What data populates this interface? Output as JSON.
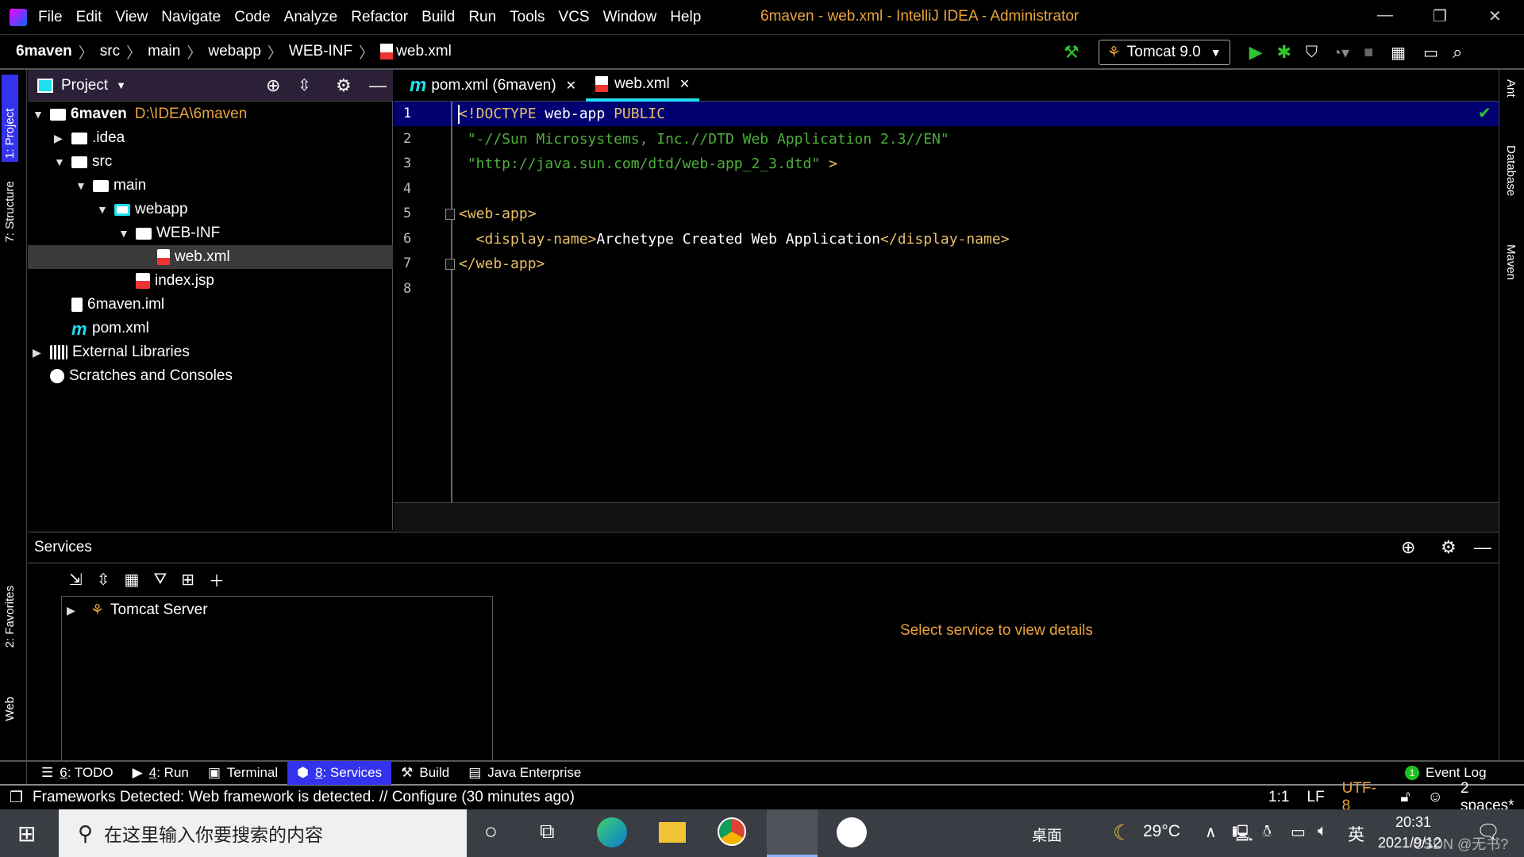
{
  "app": {
    "title": "6maven - web.xml - IntelliJ IDEA - Administrator",
    "menu": [
      "File",
      "Edit",
      "View",
      "Navigate",
      "Code",
      "Analyze",
      "Refactor",
      "Build",
      "Run",
      "Tools",
      "VCS",
      "Window",
      "Help"
    ]
  },
  "breadcrumb": [
    "6maven",
    "src",
    "main",
    "webapp",
    "WEB-INF",
    "web.xml"
  ],
  "run_config": "Tomcat 9.0",
  "project": {
    "title": "Project",
    "tree": [
      {
        "label": "6maven",
        "path": "D:\\IDEA\\6maven",
        "depth": 0,
        "expanded": true,
        "icon": "module-folder"
      },
      {
        "label": ".idea",
        "depth": 1,
        "expanded": false,
        "icon": "folder"
      },
      {
        "label": "src",
        "depth": 1,
        "expanded": true,
        "icon": "folder"
      },
      {
        "label": "main",
        "depth": 2,
        "expanded": true,
        "icon": "folder"
      },
      {
        "label": "webapp",
        "depth": 3,
        "expanded": true,
        "icon": "web-folder"
      },
      {
        "label": "WEB-INF",
        "depth": 4,
        "expanded": true,
        "icon": "folder"
      },
      {
        "label": "web.xml",
        "depth": 5,
        "icon": "xml-file",
        "selected": true
      },
      {
        "label": "index.jsp",
        "depth": 4,
        "icon": "jsp-file"
      },
      {
        "label": "6maven.iml",
        "depth": 1,
        "icon": "iml-file"
      },
      {
        "label": "pom.xml",
        "depth": 1,
        "icon": "maven-file"
      },
      {
        "label": "External Libraries",
        "depth": 0,
        "expanded": false,
        "icon": "libraries"
      },
      {
        "label": "Scratches and Consoles",
        "depth": 0,
        "icon": "scratches"
      }
    ]
  },
  "editor": {
    "tabs": [
      {
        "label": "pom.xml (6maven)",
        "active": false
      },
      {
        "label": "web.xml",
        "active": true
      }
    ],
    "lines": [
      [
        [
          "tag",
          "<!DOCTYPE "
        ],
        [
          "txt",
          "web-app "
        ],
        [
          "kw",
          "PUBLIC"
        ]
      ],
      [
        [
          "str",
          " \"-//Sun Microsystems, Inc.//DTD Web Application 2.3//EN\""
        ]
      ],
      [
        [
          "str",
          " \"http://java.sun.com/dtd/web-app_2_3.dtd\""
        ],
        [
          "tag",
          " >"
        ]
      ],
      [],
      [
        [
          "tag",
          "<web-app>"
        ]
      ],
      [
        [
          "tag",
          "  <display-name>"
        ],
        [
          "txt",
          "Archetype Created Web Application"
        ],
        [
          "tag",
          "</display-name>"
        ]
      ],
      [
        [
          "tag",
          "</web-app>"
        ]
      ],
      []
    ]
  },
  "left_stripe": [
    "1: Project",
    "7: Structure",
    "2: Favorites",
    "Web"
  ],
  "right_stripe": [
    "Ant",
    "Database",
    "Maven"
  ],
  "services": {
    "title": "Services",
    "tree": [
      "Tomcat Server"
    ],
    "detail": "Select service to view details"
  },
  "tool_windows": [
    {
      "key": "6",
      "label": ": TODO",
      "icon": "list-icon"
    },
    {
      "key": "4",
      "label": ": Run",
      "icon": "play-icon"
    },
    {
      "key": "",
      "label": "Terminal",
      "icon": "terminal-icon"
    },
    {
      "key": "8",
      "label": ": Services",
      "icon": "services-icon",
      "active": true
    },
    {
      "key": "",
      "label": "Build",
      "icon": "hammer-icon"
    },
    {
      "key": "",
      "label": "Java Enterprise",
      "icon": "java-ee-icon"
    }
  ],
  "event_log": {
    "count": "1",
    "label": "Event Log"
  },
  "status": {
    "message": "Frameworks Detected: Web framework is detected. // Configure (30 minutes ago)",
    "position": "1:1",
    "line_sep": "LF",
    "encoding": "UTF-8",
    "indent": "2 spaces*"
  },
  "taskbar": {
    "search_placeholder": "在这里输入你要搜索的内容",
    "desktop": "桌面",
    "weather": "29°C",
    "ime": "英",
    "time": "20:31",
    "date": "2021/9/12",
    "watermark": "CSDN @无书?"
  },
  "colors": {
    "accent_tab": "#1ee0f0",
    "current_line": "#000070",
    "services_active": "#3333ee",
    "warning_text": "#e8a33c"
  }
}
